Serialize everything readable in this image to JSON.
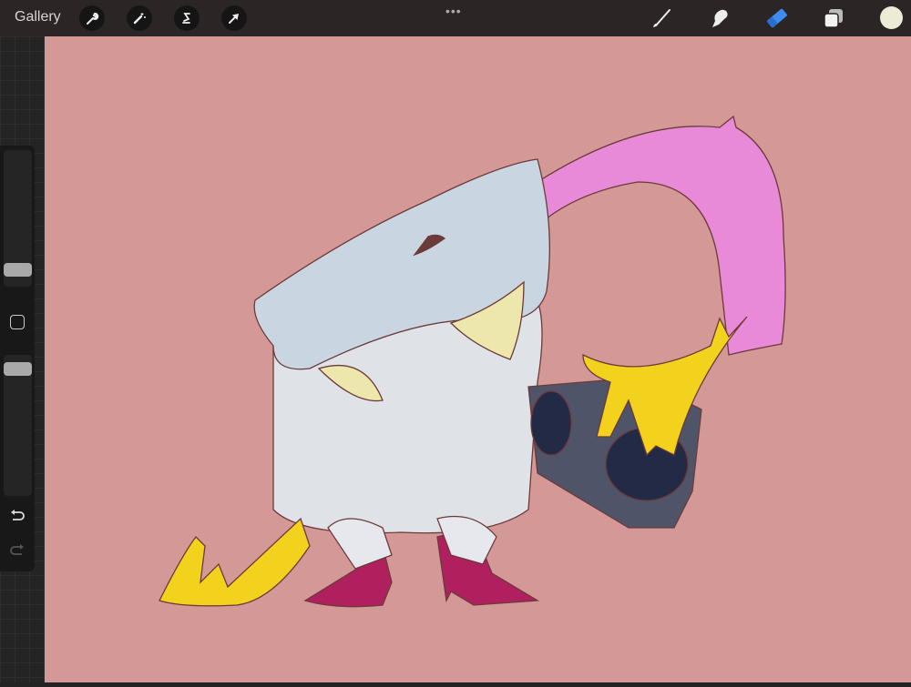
{
  "topbar": {
    "gallery_label": "Gallery",
    "more_icon": "•••"
  },
  "tools_left": [
    "wrench-icon",
    "magic-wand-icon",
    "selection-icon",
    "transform-arrow-icon"
  ],
  "tools_right": [
    "brush-icon",
    "smudge-icon",
    "eraser-icon",
    "layers-icon",
    "color-swatch"
  ],
  "active_tool": "eraser",
  "accent_color": "#3d8df0",
  "current_color": "#ecebd6",
  "sidebar": {
    "brush_size": 0.08,
    "brush_opacity": 0.94
  },
  "canvas": {
    "background_color": "#d49896"
  }
}
